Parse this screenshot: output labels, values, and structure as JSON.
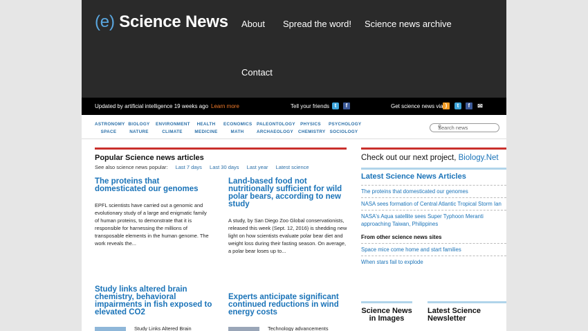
{
  "header": {
    "logo_prefix": "(e)",
    "logo_name": "Science News",
    "nav": [
      "About",
      "Spread the word!",
      "Science news archive",
      "Contact"
    ]
  },
  "infobar": {
    "updated": "Updated by artificial intelligence 19 weeks ago",
    "learn_more": "Learn more",
    "tell_friends": "Tell your friends",
    "get_news": "Get science news via"
  },
  "categories": [
    [
      "Astronomy",
      "Space"
    ],
    [
      "Biology",
      "Nature"
    ],
    [
      "Environment",
      "Climate"
    ],
    [
      "Health",
      "Medicine"
    ],
    [
      "Economics",
      "Math"
    ],
    [
      "Paleontology",
      "Archaeology"
    ],
    [
      "Physics",
      "Chemistry"
    ],
    [
      "Psychology",
      "Sociology"
    ]
  ],
  "search": {
    "placeholder": "Search news"
  },
  "main": {
    "title": "Popular Science news articles",
    "see_also": "See also science news popular:",
    "periods": [
      "Last 7 days",
      "Last 30 days",
      "Last year",
      "Latest science"
    ],
    "articles": [
      {
        "title": "The proteins that domesticated our genomes",
        "summary": "EPFL scientists have carried out a genomic and evolutionary study of a large and enigmatic family of human proteins, to demonstrate that it is responsible for harnessing the millions of transposable elements in the human genome. The work reveals the..."
      },
      {
        "title": "Land-based food not nutritionally sufficient for wild polar bears, according to new study",
        "summary": "A study, by San Diego Zoo Global conservationists, released this week (Sept. 12, 2016) is shedding new light on how scientists evaluate polar bear diet and weight loss during their fasting season. On average, a polar bear loses up to..."
      },
      {
        "title": "Study links altered brain chemistry, behavioral impairments in fish exposed to elevated CO2",
        "summary": "Study Links Altered Brain"
      },
      {
        "title": "Experts anticipate significant continued reductions in wind energy costs",
        "summary": "Technology advancements"
      }
    ]
  },
  "sidebar": {
    "project_text": "Check out our next project,",
    "project_link": "Biology.Net",
    "latest_title": "Latest Science News Articles",
    "latest": [
      "The proteins that domesticated our genomes",
      "NASA sees formation of Central Atlantic Tropical Storm Ian",
      "NASA's Aqua satellite sees Super Typhoon Meranti approaching Taiwan, Philippines"
    ],
    "other_title": "From other science news sites",
    "other": [
      "Space mice come home and start families",
      "When stars fail to explode"
    ],
    "box1": "Science News in Images",
    "box2": "Latest Science Newsletter"
  },
  "colors": {
    "header_bg": "#2a2a2a",
    "accent_blue": "#1a73b8",
    "accent_red": "#c9302c",
    "learn_more": "#f07a2a"
  }
}
